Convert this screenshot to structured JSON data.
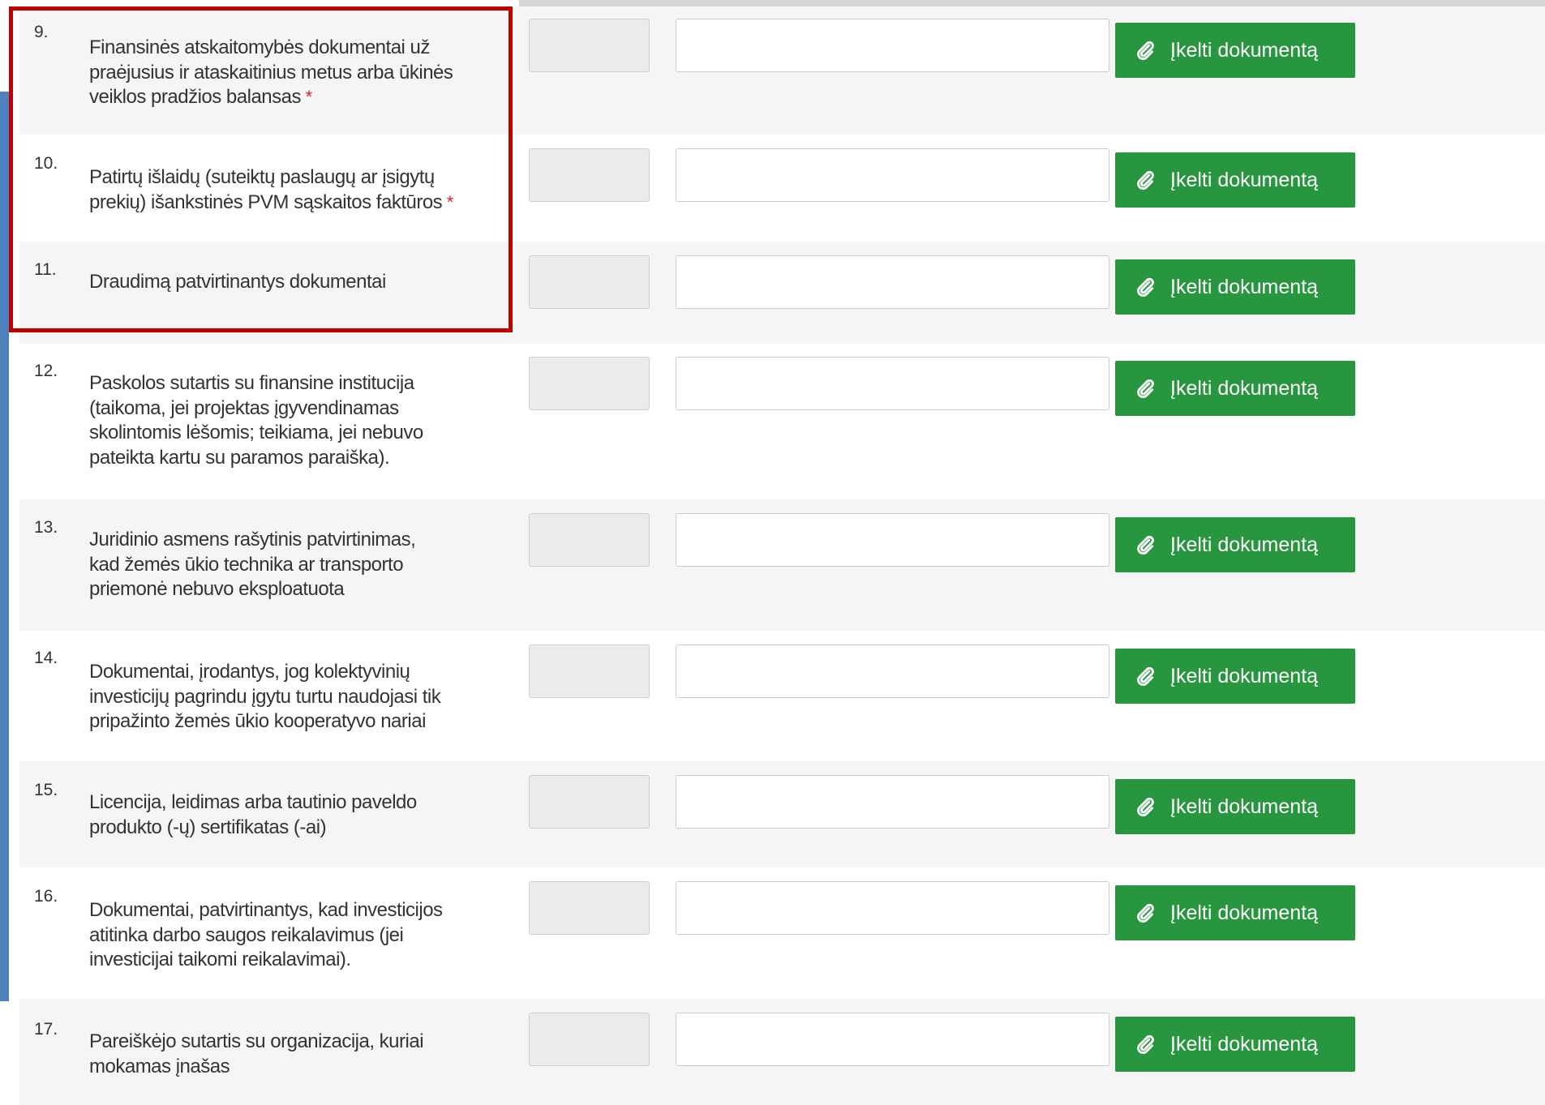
{
  "upload_label": "Įkelti dokumentą",
  "required_mark": "*",
  "colors": {
    "button": "#27963e",
    "highlight": "#c00000",
    "required": "#e02020",
    "left_accent": "#4f81bd"
  },
  "rows": [
    {
      "number": "9.",
      "lines": [
        "Finansinės atskaitomybės dokumentai už",
        "praėjusius ir ataskaitinius metus arba ūkinės",
        "veiklos pradžios balansas"
      ],
      "required": true
    },
    {
      "number": "10.",
      "lines": [
        "Patirtų išlaidų (suteiktų paslaugų ar įsigytų",
        "prekių) išankstinės PVM sąskaitos faktūros"
      ],
      "required": true
    },
    {
      "number": "11.",
      "lines": [
        "Draudimą patvirtinantys dokumentai"
      ],
      "required": false
    },
    {
      "number": "12.",
      "lines": [
        "Paskolos sutartis su finansine institucija",
        "(taikoma, jei projektas įgyvendinamas",
        "skolintomis lėšomis; teikiama, jei nebuvo",
        "pateikta kartu su paramos paraiška)."
      ],
      "required": false
    },
    {
      "number": "13.",
      "lines": [
        "Juridinio asmens rašytinis patvirtinimas,",
        "kad žemės ūkio technika ar transporto",
        "priemonė nebuvo eksploatuota"
      ],
      "required": false
    },
    {
      "number": "14.",
      "lines": [
        "Dokumentai, įrodantys, jog kolektyvinių",
        "investicijų pagrindu įgytu turtu naudojasi tik",
        "pripažinto žemės ūkio kooperatyvo nariai"
      ],
      "required": false
    },
    {
      "number": "15.",
      "lines": [
        "Licencija, leidimas arba tautinio paveldo",
        "produkto (-ų) sertifikatas  (-ai)"
      ],
      "required": false
    },
    {
      "number": "16.",
      "lines": [
        "Dokumentai, patvirtinantys, kad investicijos",
        "atitinka darbo saugos reikalavimus (jei",
        "investicijai taikomi reikalavimai)."
      ],
      "required": false
    },
    {
      "number": "17.",
      "lines": [
        "Pareiškėjo sutartis su organizacija, kuriai",
        "mokamas įnašas"
      ],
      "required": false
    }
  ]
}
